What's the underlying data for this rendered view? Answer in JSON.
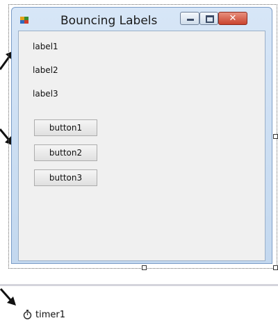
{
  "form": {
    "title": "Bouncing Labels",
    "labels": [
      "label1",
      "label2",
      "label3"
    ],
    "buttons": [
      "button1",
      "button2",
      "button3"
    ]
  },
  "component_tray": {
    "items": [
      {
        "label": "timer1",
        "icon": "stopwatch-icon"
      }
    ]
  },
  "colors": {
    "close_button": "#c9432e",
    "title_bar": "#c3d8ef",
    "client_area": "#f0f0f0"
  }
}
